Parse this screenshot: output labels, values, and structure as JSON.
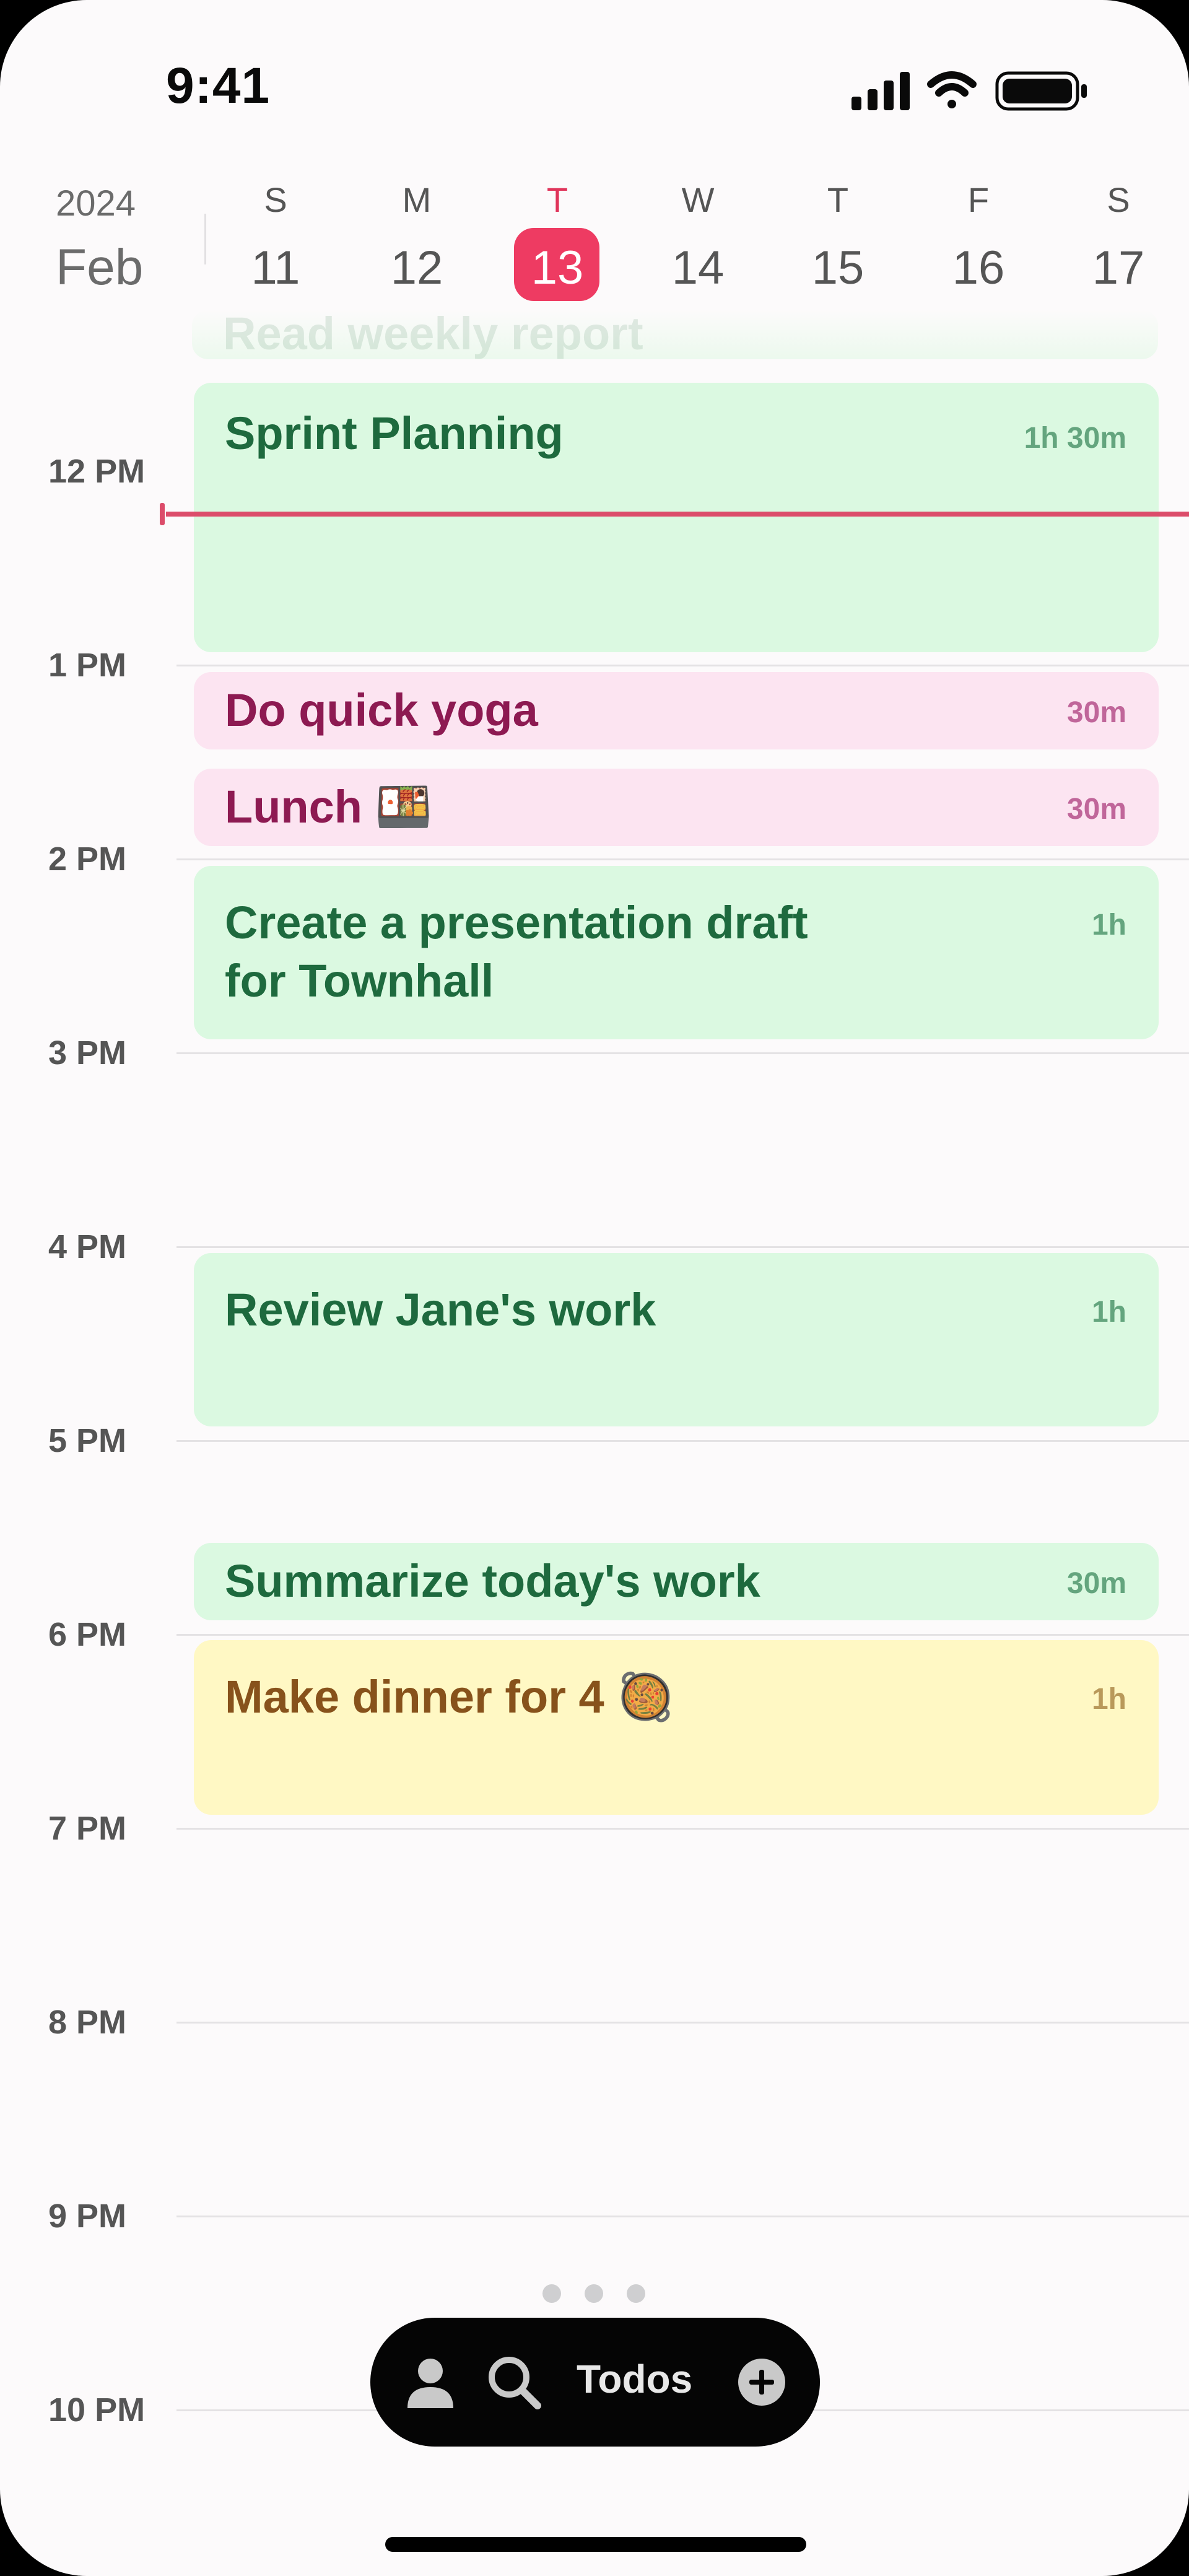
{
  "status_bar": {
    "time": "9:41"
  },
  "week": {
    "year": "2024",
    "month": "Feb",
    "days": [
      {
        "letter": "S",
        "number": "11"
      },
      {
        "letter": "M",
        "number": "12"
      },
      {
        "letter": "T",
        "number": "13",
        "today": true
      },
      {
        "letter": "W",
        "number": "14"
      },
      {
        "letter": "T",
        "number": "15"
      },
      {
        "letter": "F",
        "number": "16"
      },
      {
        "letter": "S",
        "number": "17"
      }
    ]
  },
  "faded_event_title": "Read weekly report",
  "hours": [
    "12 PM",
    "1 PM",
    "2 PM",
    "3 PM",
    "4 PM",
    "5 PM",
    "6 PM",
    "7 PM",
    "8 PM",
    "9 PM",
    "10 PM"
  ],
  "events": [
    {
      "title": "Sprint Planning",
      "duration": "1h 30m",
      "color": "green"
    },
    {
      "title": "Do quick yoga",
      "duration": "30m",
      "color": "pink"
    },
    {
      "title": "Lunch 🍱",
      "duration": "30m",
      "color": "pink"
    },
    {
      "title_line1": "Create a presentation draft",
      "title_line2": "for Townhall",
      "duration": "1h",
      "color": "green"
    },
    {
      "title": "Review Jane's work",
      "duration": "1h",
      "color": "green"
    },
    {
      "title": "Summarize today's work",
      "duration": "30m",
      "color": "green"
    },
    {
      "title": "Make dinner for 4 🥘",
      "duration": "1h",
      "color": "yellow"
    }
  ],
  "toolbar": {
    "todos_label": "Todos",
    "icons": [
      "person-icon",
      "search-icon",
      "plus-circle-icon"
    ]
  },
  "colors": {
    "today_accent": "#ee3b62",
    "now_line": "#dc4c6a",
    "green_event": "#dbf9e1",
    "pink_event": "#fce4f1",
    "yellow_event": "#fff8c4"
  }
}
